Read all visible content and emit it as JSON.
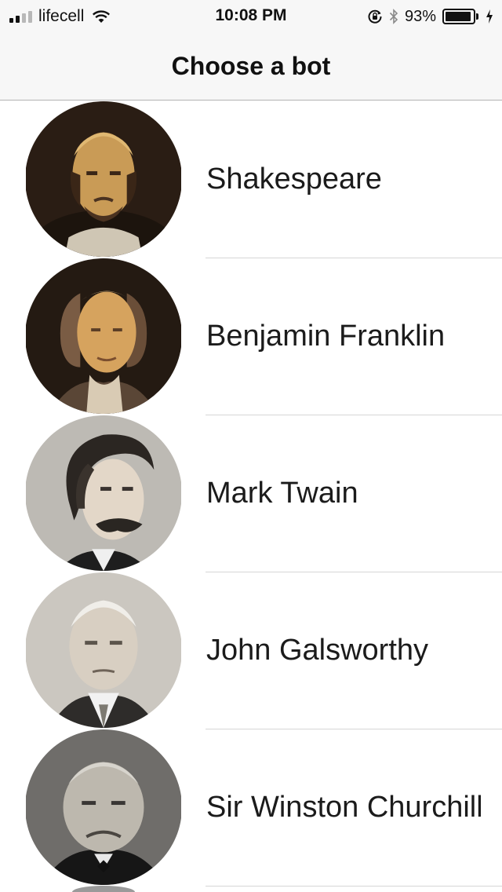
{
  "status_bar": {
    "carrier": "lifecell",
    "time": "10:08 PM",
    "battery_percent": "93%",
    "battery_level": 0.93,
    "signal_bars_filled": 2,
    "signal_bars_total": 4
  },
  "nav": {
    "title": "Choose a bot"
  },
  "bots": [
    {
      "name": "Shakespeare",
      "avatar": "shakespeare-portrait"
    },
    {
      "name": "Benjamin Franklin",
      "avatar": "franklin-portrait"
    },
    {
      "name": "Mark Twain",
      "avatar": "twain-portrait"
    },
    {
      "name": "John Galsworthy",
      "avatar": "galsworthy-portrait"
    },
    {
      "name": "Sir Winston Churchill",
      "avatar": "churchill-portrait"
    }
  ],
  "colors": {
    "nav_background": "#f7f7f7",
    "separator": "#d6d6d6",
    "text": "#1b1b1b"
  }
}
